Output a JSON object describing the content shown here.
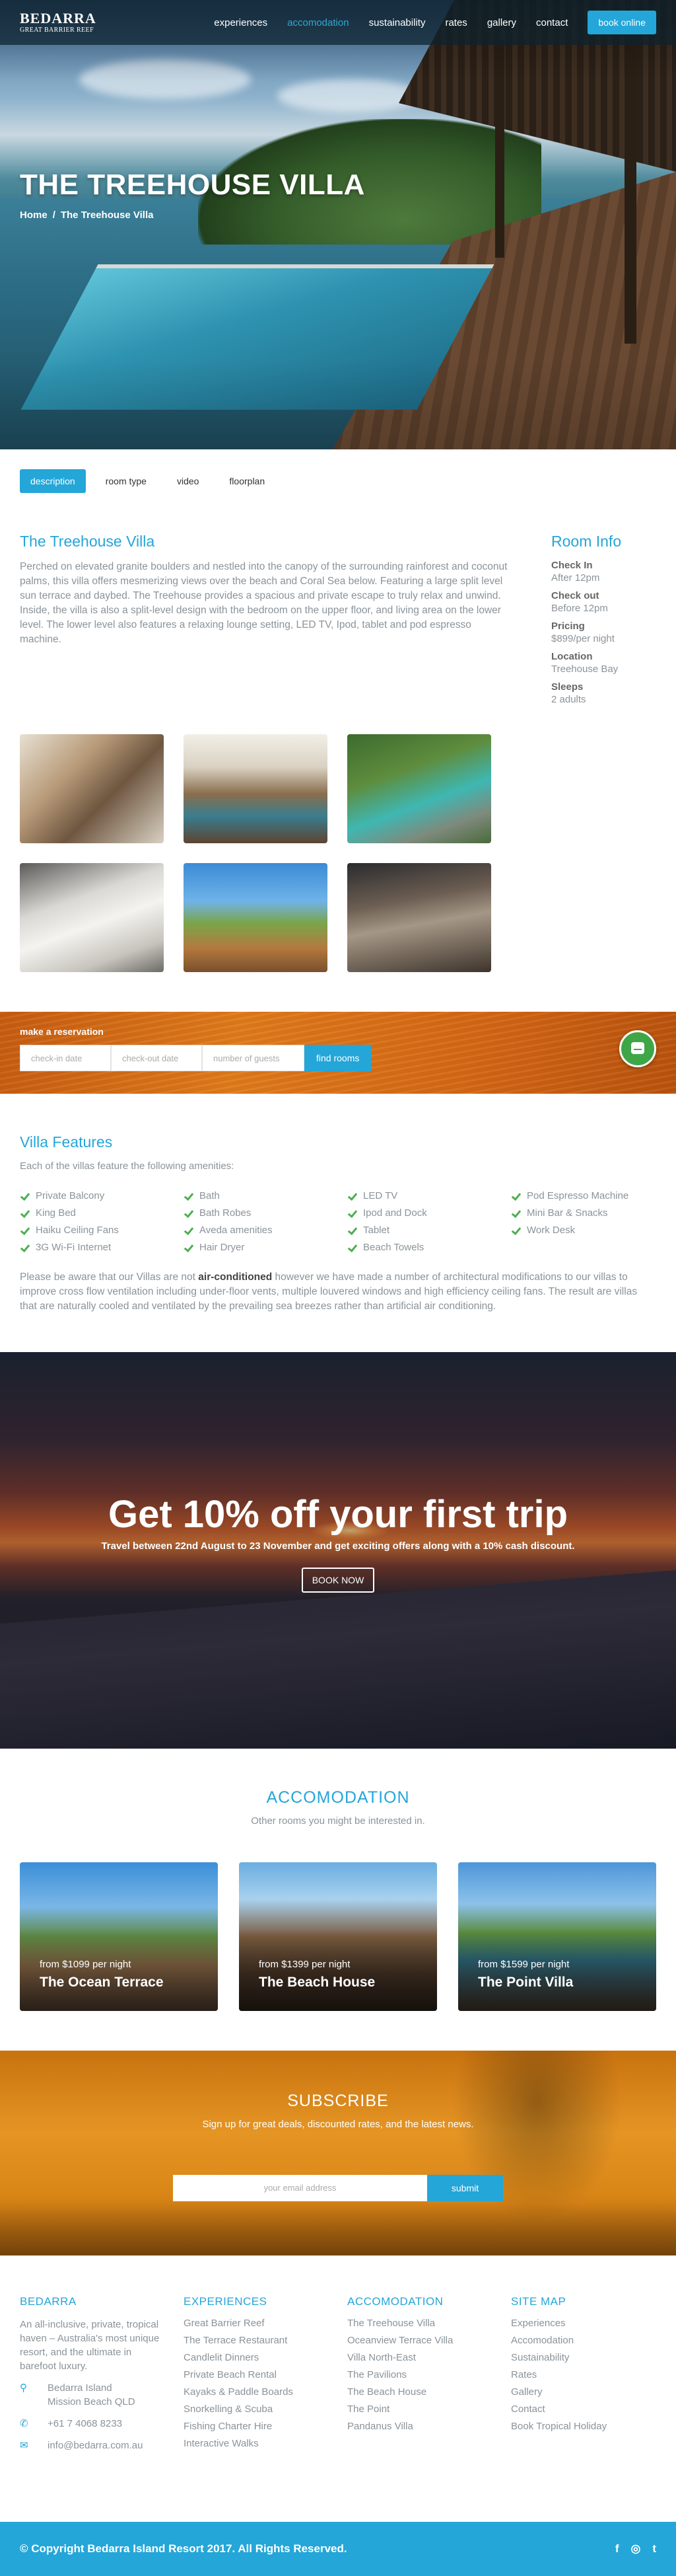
{
  "brand": {
    "name": "BEDARRA",
    "tagline": "GREAT BARRIER REEF"
  },
  "nav": {
    "links": [
      "experiences",
      "accomodation",
      "sustainability",
      "rates",
      "gallery",
      "contact"
    ],
    "active": "accomodation",
    "cta": "book online"
  },
  "hero": {
    "title": "THE TREEHOUSE VILLA",
    "breadcrumb": [
      "Home",
      "The Treehouse Villa"
    ]
  },
  "tabs": [
    "description",
    "room type",
    "video",
    "floorplan"
  ],
  "intro": {
    "title": "The Treehouse Villa",
    "body": "Perched on elevated granite boulders and nestled into the canopy of the surrounding rainforest and coconut palms, this villa offers mesmerizing views over the beach and Coral Sea below. Featuring a large split level sun terrace and daybed. The Treehouse provides a spacious and private escape to truly relax and unwind. Inside, the villa is also a split-level design with the bedroom on the upper floor, and living area on the lower level. The lower level also features a relaxing lounge setting, LED TV, Ipod, tablet and pod espresso machine."
  },
  "room_info": {
    "title": "Room Info",
    "items": [
      {
        "label": "Check In",
        "value": "After 12pm"
      },
      {
        "label": "Check out",
        "value": "Before 12pm"
      },
      {
        "label": "Pricing",
        "value": "$899/per night"
      },
      {
        "label": "Location",
        "value": "Treehouse Bay"
      },
      {
        "label": "Sleeps",
        "value": "2 adults"
      }
    ]
  },
  "reservation": {
    "label": "make a reservation",
    "checkin": "check-in date",
    "checkout": "check-out date",
    "guests": "number of guests",
    "button": "find rooms"
  },
  "features": {
    "title": "Villa Features",
    "subtitle": "Each of the villas feature the following amenities:",
    "items": [
      "Private Balcony",
      "Bath",
      "LED TV",
      "Pod Espresso Machine",
      "King Bed",
      "Bath Robes",
      "Ipod and Dock",
      "Mini Bar & Snacks",
      "Haiku Ceiling Fans",
      "Aveda amenities",
      "Tablet",
      "Work Desk",
      "3G Wi-Fi Internet",
      "Hair Dryer",
      "Beach Towels"
    ],
    "note_before": "Please be aware that our Villas are not ",
    "note_bold": "air-conditioned",
    "note_after": " however we have made a number of architectural modifications to our villas to improve cross flow ventilation including under-floor vents, multiple louvered windows and high efficiency ceiling fans. The result are villas that are naturally cooled and ventilated by the prevailing sea breezes rather than artificial air conditioning."
  },
  "promo": {
    "title": "Get 10% off your first trip",
    "text": "Travel between 22nd August to 23 November and get exciting offers along with a 10% cash discount.",
    "button": "BOOK NOW"
  },
  "accomodation": {
    "title": "ACCOMODATION",
    "subtitle": "Other rooms you might be interested in.",
    "cards": [
      {
        "price": "from $1099 per night",
        "name": "The Ocean Terrace"
      },
      {
        "price": "from $1399 per night",
        "name": "The Beach House"
      },
      {
        "price": "from $1599 per night",
        "name": "The Point Villa"
      }
    ]
  },
  "subscribe": {
    "title": "SUBSCRIBE",
    "text": "Sign up for great deals, discounted rates, and the latest news.",
    "placeholder": "your email address",
    "button": "submit"
  },
  "footer": {
    "about_title": "BEDARRA",
    "about": "An all-inclusive, private, tropical haven – Australia's most unique resort, and the ultimate in barefoot luxury.",
    "address": "Bedarra Island\nMission Beach QLD",
    "phone": "+61 7 4068 8233",
    "email": "info@bedarra.com.au",
    "experiences_title": "EXPERIENCES",
    "experiences": [
      "Great Barrier Reef",
      "The Terrace Restaurant",
      "Candlelit Dinners",
      "Private Beach Rental",
      "Kayaks & Paddle Boards",
      "Snorkelling & Scuba",
      "Fishing Charter Hire",
      "Interactive Walks"
    ],
    "accomodation_title": "ACCOMODATION",
    "accomodation": [
      "The Treehouse Villa",
      "Oceanview Terrace Villa",
      "Villa North-East",
      "The Pavilions",
      "The Beach House",
      "The Point",
      "Pandanus Villa"
    ],
    "sitemap_title": "SITE MAP",
    "sitemap": [
      "Experiences",
      "Accomodation",
      "Sustainability",
      "Rates",
      "Gallery",
      "Contact",
      "Book Tropical Holiday"
    ],
    "copyright": "© Copyright Bedarra Island Resort 2017. All Rights Reserved.",
    "social": {
      "facebook": "f",
      "instagram": "◎",
      "twitter": "t"
    }
  },
  "colors": {
    "accent": "#24a6d8",
    "check": "#4caf50",
    "orange": "#e07a1a"
  }
}
